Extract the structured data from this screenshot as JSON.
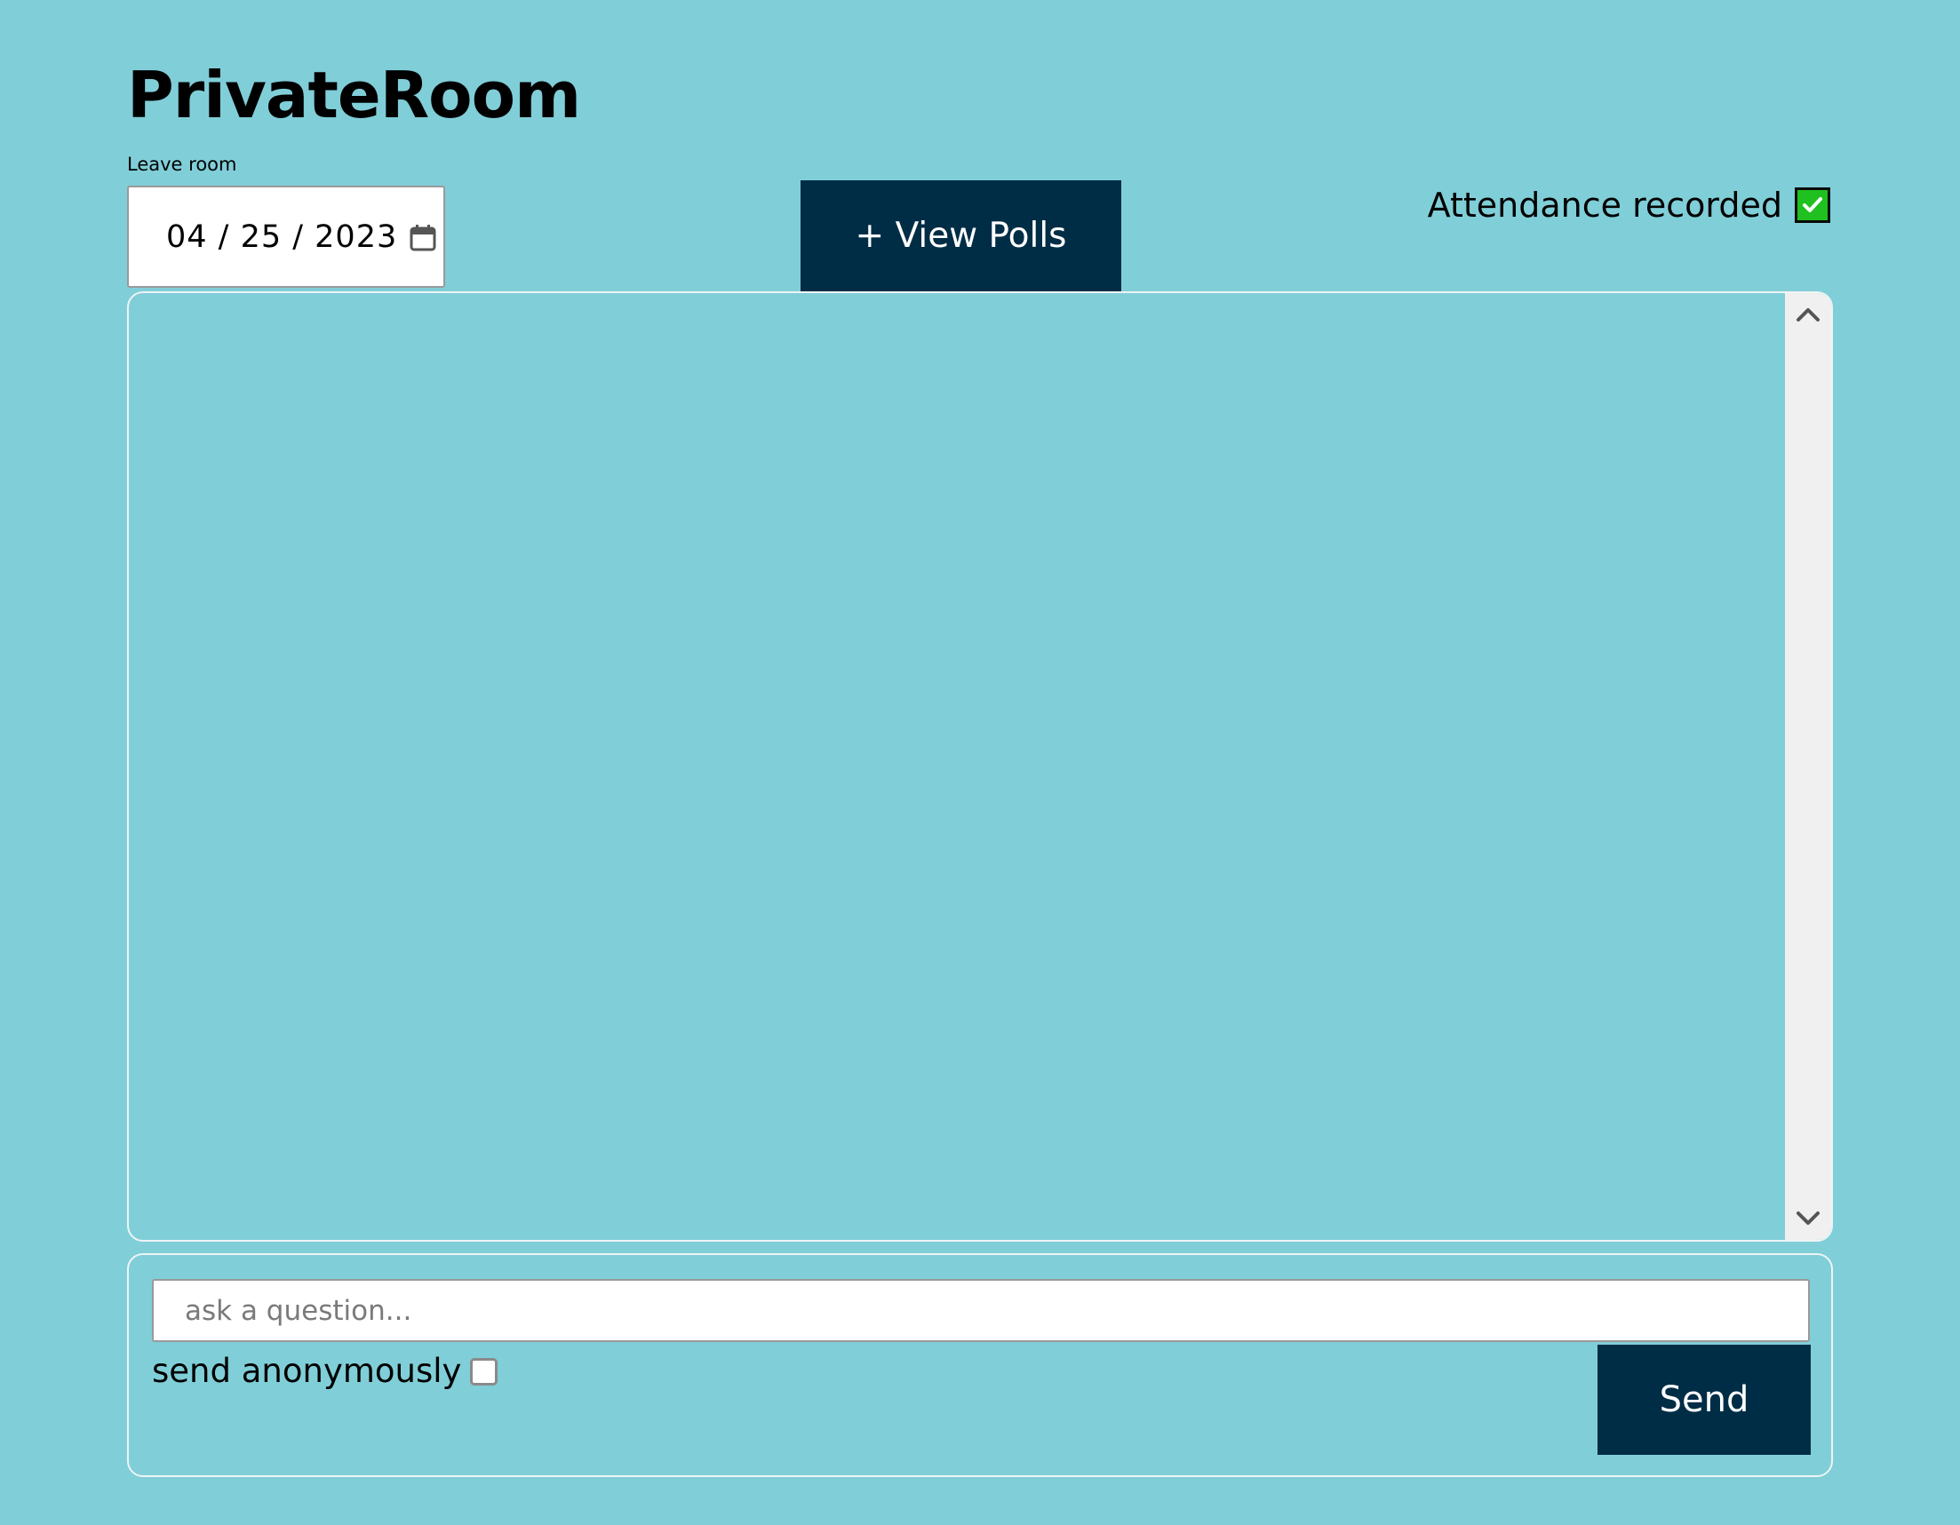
{
  "header": {
    "title": "PrivateRoom",
    "leave_room_label": "Leave room"
  },
  "date_input": {
    "value": "04 / 25 / 2023",
    "icon": "calendar-icon"
  },
  "view_polls": {
    "label": "+ View Polls"
  },
  "attendance": {
    "label": "Attendance recorded",
    "checked": true,
    "icon": "checkmark-icon"
  },
  "chat": {
    "messages": [],
    "scroll_up_icon": "chevron-up-icon",
    "scroll_down_icon": "chevron-down-icon"
  },
  "compose": {
    "placeholder": "ask a question...",
    "value": "",
    "anonymous_label": "send anonymously",
    "anonymous_checked": false,
    "send_label": "Send"
  },
  "colors": {
    "background": "#80ced8",
    "primary_button": "#002d46",
    "attendance_check": "#1fc01f",
    "scrollbar_track": "#f0f0f0"
  }
}
